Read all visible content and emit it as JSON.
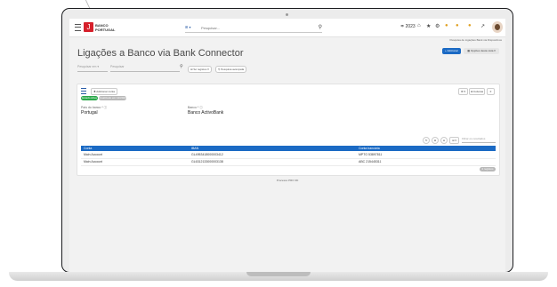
{
  "app": {
    "logo_letter": "J",
    "logo_text": "BANCO PORTUGAL"
  },
  "search": {
    "filter_label": "⊞ ▾",
    "placeholder": "Pesquisar..."
  },
  "topbar": {
    "year": "≑ 2023"
  },
  "breadcrumb": {
    "text": "Pesquisa de Ligações Bank via Dispositivos"
  },
  "page": {
    "title": "Ligações a Banco via Bank Connector"
  },
  "actions": {
    "new_label": "+ Adicionar",
    "options_label": "▦ Opções desta vista ▾"
  },
  "filters": {
    "select_label": "Pesquisar em ▾",
    "input_placeholder": "Pesquisar",
    "chip1": "⊞ Só registos ▾",
    "chip2": "⚲ Pesquisa avançada"
  },
  "card": {
    "action_btn": "✚ Adicionar conta",
    "status_active": "Estado Ativa",
    "status_info": "Atualizado em 12/2023",
    "tools": [
      "⚙ ▾",
      "⊞ Colunas",
      "≡"
    ],
    "fields": [
      {
        "label": "País do banco * ⓘ",
        "value": "Portugal"
      },
      {
        "label": "Banco * ⓘ",
        "value": "Banco ActivoBank"
      }
    ],
    "table_tools": [
      "⟲",
      "⊕",
      "⊖",
      "⊞ ▾"
    ],
    "table_search_placeholder": "Filtrar os resultados",
    "columns": [
      "Conta",
      "IBAN",
      "Conta bancária"
    ],
    "rows": [
      {
        "conta": "Main Account",
        "iban": "GL4953418000003412",
        "conta_bancaria": "MPTO 53897811"
      },
      {
        "conta": "Main Account",
        "iban": "GL6312133000003138",
        "conta_bancaria": "ABC 215445311"
      }
    ],
    "total_label": "2 registos"
  },
  "footer": {
    "text": "Processo PRO 3D"
  }
}
